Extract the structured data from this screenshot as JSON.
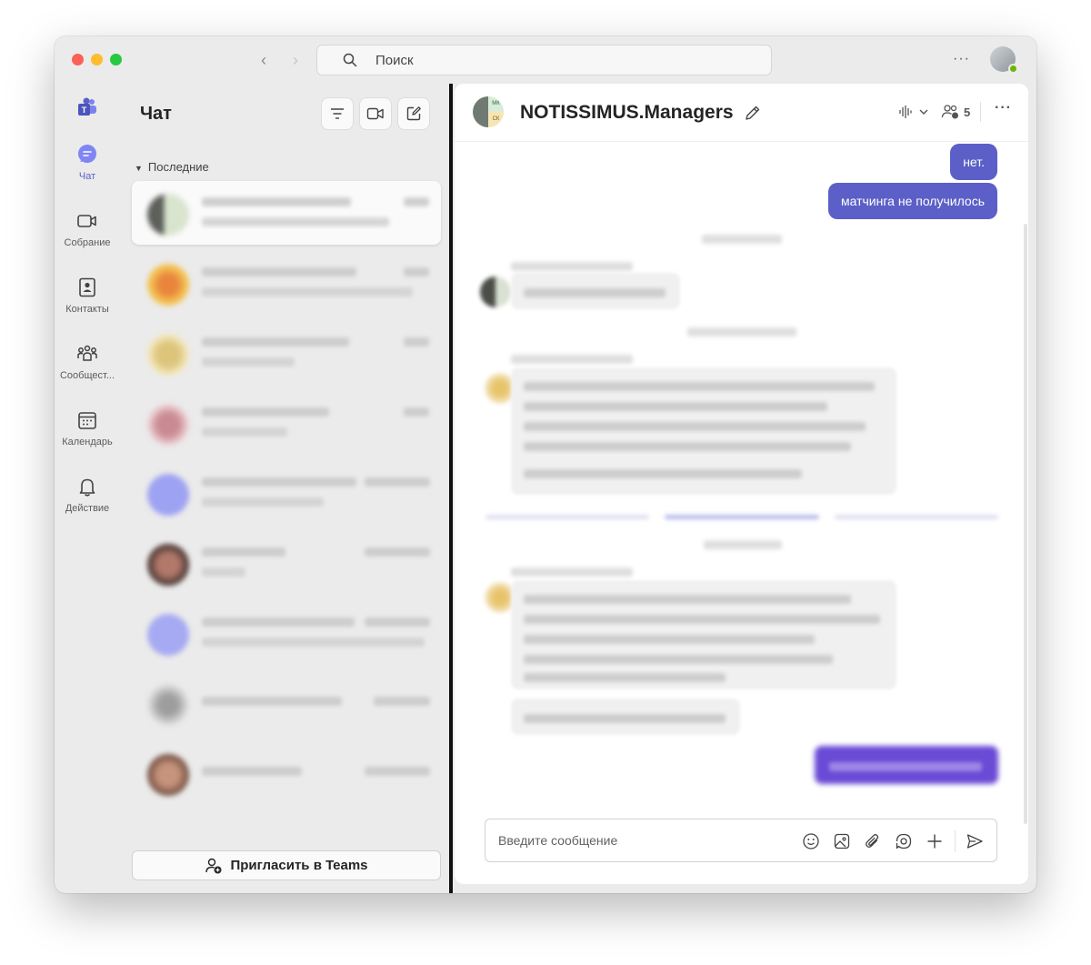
{
  "search": {
    "placeholder": "Поиск"
  },
  "rail": {
    "items": [
      {
        "label": "Чат",
        "icon": "chat-icon",
        "active": true
      },
      {
        "label": "Собрание",
        "icon": "video-camera-icon"
      },
      {
        "label": "Контакты",
        "icon": "contacts-icon"
      },
      {
        "label": "Сообщест...",
        "icon": "communities-icon"
      },
      {
        "label": "Календарь",
        "icon": "calendar-icon"
      },
      {
        "label": "Действие",
        "icon": "bell-icon"
      }
    ]
  },
  "list": {
    "title": "Чат",
    "section": "Последние",
    "invite_label": "Пригласить в Teams"
  },
  "conversation": {
    "title": "NOTISSIMUS.Managers",
    "avatar_initials_1": "МК",
    "avatar_initials_2": "СК",
    "participants_count": "5",
    "messages_me": [
      "нет.",
      "матчинга не получилось"
    ],
    "composer_placeholder": "Введите сообщение"
  },
  "colors": {
    "accent": "#5b5fc7",
    "online": "#6bb700"
  }
}
